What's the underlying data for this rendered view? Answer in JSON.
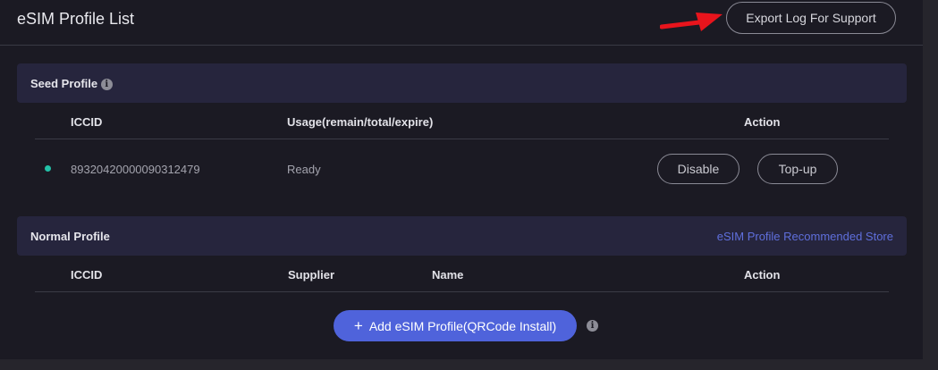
{
  "header": {
    "title": "eSIM Profile List",
    "export_label": "Export Log For Support"
  },
  "seed_section": {
    "title": "Seed Profile",
    "columns": {
      "iccid": "ICCID",
      "usage": "Usage(remain/total/expire)",
      "action": "Action"
    },
    "rows": [
      {
        "iccid": "89320420000090312479",
        "usage": "Ready",
        "status_color": "#23c1a8",
        "actions": [
          "Disable",
          "Top-up"
        ]
      }
    ]
  },
  "normal_section": {
    "title": "Normal Profile",
    "store_link": "eSIM Profile Recommended Store",
    "columns": {
      "iccid": "ICCID",
      "supplier": "Supplier",
      "name": "Name",
      "action": "Action"
    },
    "add_button": {
      "icon": "plus-icon",
      "label": "Add eSIM Profile(QRCode Install)"
    }
  },
  "colors": {
    "accent": "#4f63db",
    "link": "#5f6fdc",
    "annotation_arrow": "#e8141c"
  },
  "icons": {
    "info": "info-icon",
    "annotation": "red-arrow-icon"
  }
}
